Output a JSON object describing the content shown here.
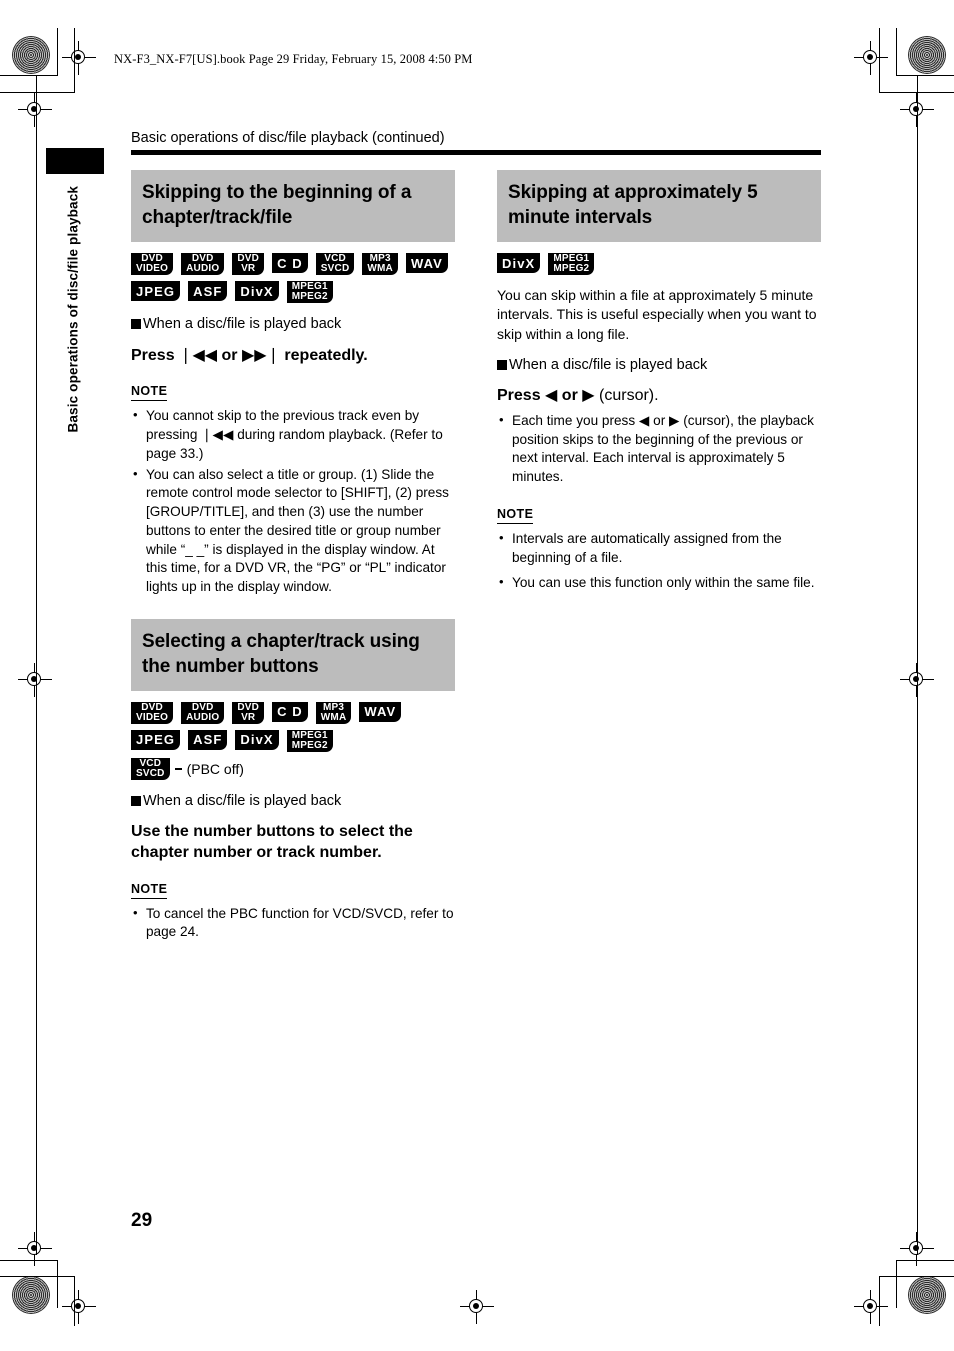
{
  "print_marks": {
    "book_line": "NX-F3_NX-F7[US].book  Page 29  Friday, February 15, 2008  4:50 PM"
  },
  "sidebar": {
    "label": "Basic operations of disc/file playback"
  },
  "header": {
    "running_head": "Basic operations of disc/file playback (continued)"
  },
  "page": {
    "number": "29"
  },
  "left_column": {
    "section1": {
      "title": "Skipping to the beginning of a chapter/track/file",
      "badges": [
        {
          "line1": "DVD",
          "line2": "VIDEO",
          "style": "stack"
        },
        {
          "line1": "DVD",
          "line2": "AUDIO",
          "style": "stack"
        },
        {
          "line1": "DVD",
          "line2": "VR",
          "style": "stack"
        },
        {
          "line1": "C D",
          "line2": "",
          "style": "single"
        },
        {
          "line1": "VCD",
          "line2": "SVCD",
          "style": "stack"
        },
        {
          "line1": "MP3",
          "line2": "WMA",
          "style": "stack"
        },
        {
          "line1": "WAV",
          "line2": "",
          "style": "single"
        },
        {
          "line1": "JPEG",
          "line2": "",
          "style": "single"
        },
        {
          "line1": "ASF",
          "line2": "",
          "style": "single"
        },
        {
          "line1": "DivX",
          "line2": "",
          "style": "single"
        },
        {
          "line1": "MPEG1",
          "line2": "MPEG2",
          "style": "stack"
        }
      ],
      "condition": "When a disc/file is played back",
      "instruction_before": "Press ",
      "instruction_skip_back": "❘◀◀",
      "instruction_middle": " or ",
      "instruction_skip_fwd": "▶▶❘",
      "instruction_after": " repeatedly.",
      "note_label": "NOTE",
      "notes": [
        "You cannot skip to the previous track even by pressing ❘◀◀ during random playback. (Refer to page 33.)",
        "You can also select a title or group. (1) Slide the remote control mode selector to [SHIFT], (2) press [GROUP/TITLE], and then (3) use the number buttons to enter the desired title or group number while “_ _” is displayed in the display window. At this time, for a DVD VR, the “PG” or “PL” indicator lights up in the display window."
      ]
    },
    "section2": {
      "title": "Selecting a chapter/track using the number buttons",
      "badges": [
        {
          "line1": "DVD",
          "line2": "VIDEO",
          "style": "stack"
        },
        {
          "line1": "DVD",
          "line2": "AUDIO",
          "style": "stack"
        },
        {
          "line1": "DVD",
          "line2": "VR",
          "style": "stack"
        },
        {
          "line1": "C D",
          "line2": "",
          "style": "single"
        },
        {
          "line1": "MP3",
          "line2": "WMA",
          "style": "stack"
        },
        {
          "line1": "WAV",
          "line2": "",
          "style": "single"
        },
        {
          "line1": "JPEG",
          "line2": "",
          "style": "single"
        },
        {
          "line1": "ASF",
          "line2": "",
          "style": "single"
        },
        {
          "line1": "DivX",
          "line2": "",
          "style": "single"
        },
        {
          "line1": "MPEG1",
          "line2": "MPEG2",
          "style": "stack"
        }
      ],
      "pbc_badge": {
        "line1": "VCD",
        "line2": "SVCD",
        "style": "stack"
      },
      "pbc_text": "(PBC off)",
      "condition": "When a disc/file is played back",
      "instruction": "Use the number buttons to select the chapter number or track number.",
      "note_label": "NOTE",
      "notes": [
        "To cancel the PBC function for VCD/SVCD, refer to page 24."
      ]
    }
  },
  "right_column": {
    "section1": {
      "title": "Skipping at approximately 5 minute intervals",
      "badges": [
        {
          "line1": "DivX",
          "line2": "",
          "style": "single"
        },
        {
          "line1": "MPEG1",
          "line2": "MPEG2",
          "style": "stack"
        }
      ],
      "body": "You can skip within a file at approximately 5 minute intervals. This is useful especially when you want to skip within a long file.",
      "condition": "When a disc/file is played back",
      "instruction_before": "Press ",
      "instruction_left": "◀",
      "instruction_middle": " or ",
      "instruction_right": "▶",
      "instruction_after": " (cursor).",
      "bullets": [
        "Each time you press ◀ or ▶ (cursor), the playback position skips to the beginning of the previous or next interval. Each interval is approximately 5 minutes."
      ],
      "note_label": "NOTE",
      "notes": [
        "Intervals are automatically assigned from the beginning of a file.",
        "You can use this function only within the same file."
      ]
    }
  },
  "colors": {
    "heading_bg": "#bcbcbc",
    "badge_bg": "#000000",
    "rule": "#000000"
  }
}
